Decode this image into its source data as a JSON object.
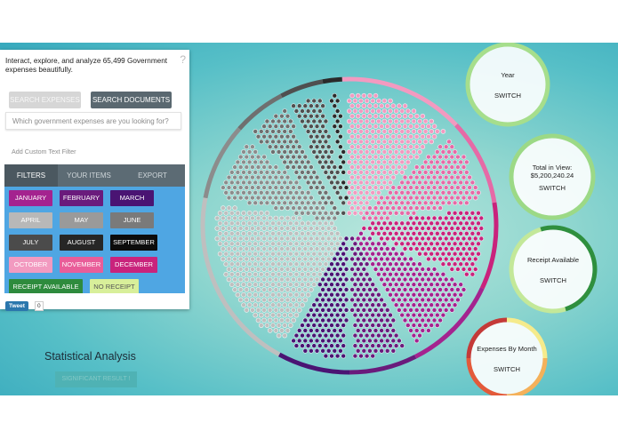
{
  "panel": {
    "intro": "Interact, explore, and analyze 65,499 Government expenses beautifully.",
    "help": "?",
    "search_expenses": "SEARCH EXPENSES",
    "search_documents": "SEARCH DOCUMENTS",
    "search_placeholder": "Which government expenses are you looking for?",
    "custom_filter": "Add Custom Text Filter",
    "tabs": [
      "FILTERS",
      "YOUR ITEMS",
      "EXPORT"
    ],
    "filters": [
      {
        "label": "JANUARY",
        "bg": "#a4238f",
        "fg": "#ffffff"
      },
      {
        "label": "FEBRUARY",
        "bg": "#6a1b7c",
        "fg": "#ffffff"
      },
      {
        "label": "MARCH",
        "bg": "#4a1473",
        "fg": "#ffffff"
      },
      {
        "label": "APRIL",
        "bg": "#b8b8b8",
        "fg": "#ffffff"
      },
      {
        "label": "MAY",
        "bg": "#9a9a9a",
        "fg": "#ffffff"
      },
      {
        "label": "JUNE",
        "bg": "#7a7a7a",
        "fg": "#ffffff"
      },
      {
        "label": "JULY",
        "bg": "#4b4b4b",
        "fg": "#ffffff"
      },
      {
        "label": "AUGUST",
        "bg": "#262626",
        "fg": "#ffffff"
      },
      {
        "label": "SEPTEMBER",
        "bg": "#0c0c0c",
        "fg": "#ffffff"
      },
      {
        "label": "OCTOBER",
        "bg": "#f29ac0",
        "fg": "#ffffff"
      },
      {
        "label": "NOVEMBER",
        "bg": "#e95d99",
        "fg": "#ffffff"
      },
      {
        "label": "DECEMBER",
        "bg": "#c9237c",
        "fg": "#ffffff"
      },
      {
        "label": "RECEIPT AVAILABLE",
        "bg": "#2e8b3d",
        "fg": "#ffffff"
      },
      {
        "label": "NO RECEIPT",
        "bg": "#d8ef9a",
        "fg": "#555555"
      }
    ],
    "tweet": "Tweet",
    "tweet_count": "0"
  },
  "stats": {
    "title": "Statistical Analysis",
    "button": "SIGNIFICANT RESULT !"
  },
  "rings": [
    {
      "label": "Year",
      "switch": "SWITCH",
      "colors": [
        "#a6de8c"
      ]
    },
    {
      "label": "Total in View:\n$5,200,240.24",
      "switch": "SWITCH",
      "colors": [
        "#9cd986"
      ]
    },
    {
      "label": "Receipt Available",
      "switch": "SWITCH",
      "colors": [
        "#2f8f3e",
        "#c3e899"
      ]
    },
    {
      "label": "Expenses By Month",
      "switch": "SWITCH",
      "colors": [
        "#f5eb8c",
        "#f4b15a",
        "#e35a3a",
        "#c43a38"
      ]
    }
  ],
  "circle": {
    "segments": [
      {
        "name": "october",
        "color": "#f29ac0",
        "count": 260
      },
      {
        "name": "november",
        "color": "#e66aa6",
        "count": 180
      },
      {
        "name": "december",
        "color": "#c9237c",
        "count": 180
      },
      {
        "name": "january",
        "color": "#a4238f",
        "count": 200
      },
      {
        "name": "february",
        "color": "#6a1b7c",
        "count": 140
      },
      {
        "name": "march",
        "color": "#4a1473",
        "count": 150
      },
      {
        "name": "april",
        "color": "#bfbfbf",
        "count": 380
      },
      {
        "name": "may",
        "color": "#8c8c8c",
        "count": 160
      },
      {
        "name": "june",
        "color": "#6f6f6f",
        "count": 110
      },
      {
        "name": "july",
        "color": "#4f4f4f",
        "count": 90
      },
      {
        "name": "august",
        "color": "#2a2a2a",
        "count": 40
      }
    ]
  }
}
